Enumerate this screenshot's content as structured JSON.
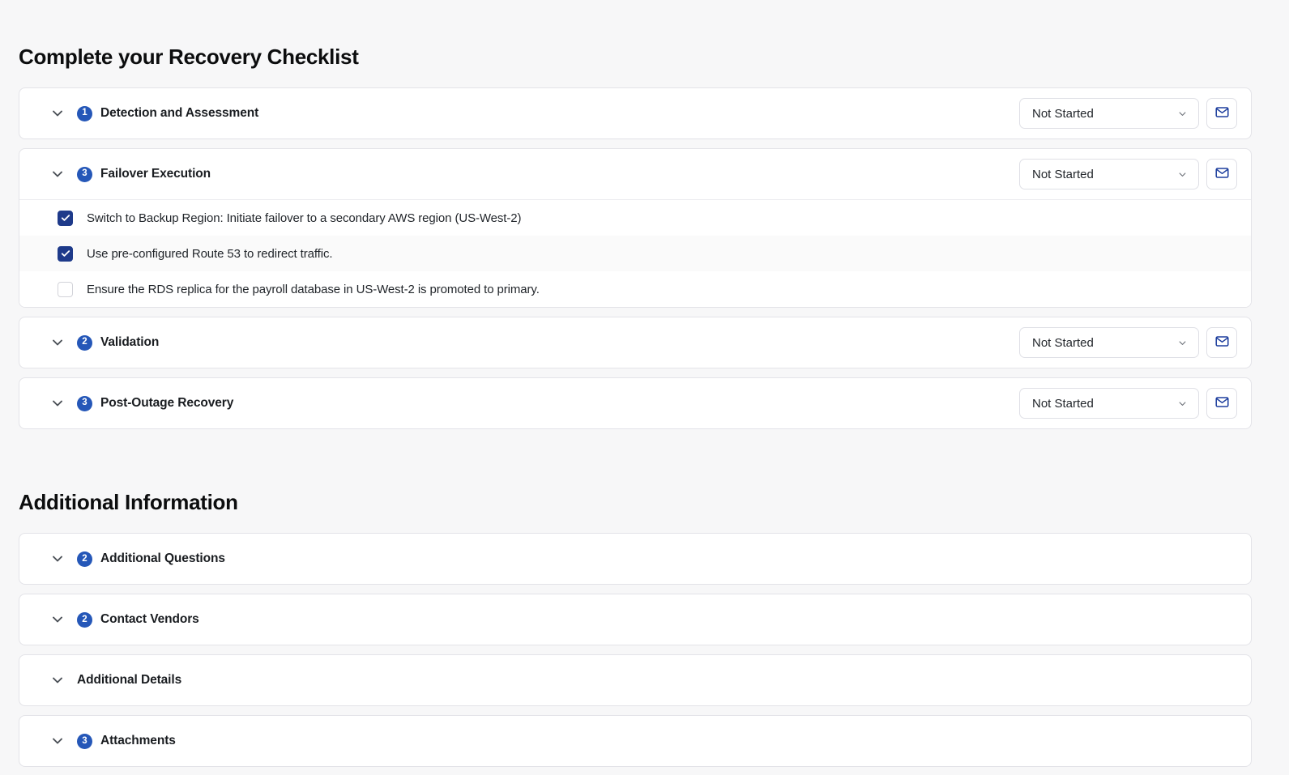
{
  "checklist": {
    "title": "Complete your Recovery Checklist",
    "sections": [
      {
        "badge": "1",
        "title": "Detection and Assessment",
        "status": "Not Started",
        "expanded": false,
        "has_badge": true,
        "has_controls": true,
        "tasks": []
      },
      {
        "badge": "3",
        "title": "Failover Execution",
        "status": "Not Started",
        "expanded": true,
        "has_badge": true,
        "has_controls": true,
        "tasks": [
          {
            "label": "Switch to Backup Region: Initiate failover to a secondary AWS region (US-West-2)",
            "checked": true
          },
          {
            "label": "Use pre-configured Route 53 to redirect traffic.",
            "checked": true
          },
          {
            "label": "Ensure the RDS replica for the payroll database in US-West-2 is promoted to primary.",
            "checked": false
          }
        ]
      },
      {
        "badge": "2",
        "title": "Validation",
        "status": "Not Started",
        "expanded": false,
        "has_badge": true,
        "has_controls": true,
        "tasks": []
      },
      {
        "badge": "3",
        "title": "Post-Outage Recovery",
        "status": "Not Started",
        "expanded": false,
        "has_badge": true,
        "has_controls": true,
        "tasks": []
      }
    ]
  },
  "additional": {
    "title": "Additional Information",
    "sections": [
      {
        "badge": "2",
        "title": "Additional Questions",
        "status": "",
        "expanded": false,
        "has_badge": true,
        "has_controls": false,
        "tasks": []
      },
      {
        "badge": "2",
        "title": "Contact Vendors",
        "status": "",
        "expanded": false,
        "has_badge": true,
        "has_controls": false,
        "tasks": []
      },
      {
        "badge": "",
        "title": "Additional Details",
        "status": "",
        "expanded": false,
        "has_badge": false,
        "has_controls": false,
        "tasks": []
      },
      {
        "badge": "3",
        "title": "Attachments",
        "status": "",
        "expanded": false,
        "has_badge": true,
        "has_controls": false,
        "tasks": []
      }
    ]
  },
  "icons": {
    "chevron": "chevron-down-icon",
    "mail": "mail-icon",
    "check": "check-icon"
  },
  "colors": {
    "badge_blue": "#2557b8",
    "checkbox_navy": "#1e3a8a",
    "mail_blue": "#1e3f9e",
    "page_bg": "#f7f7f8",
    "card_bg": "#ffffff",
    "border": "#e3e3e8"
  }
}
